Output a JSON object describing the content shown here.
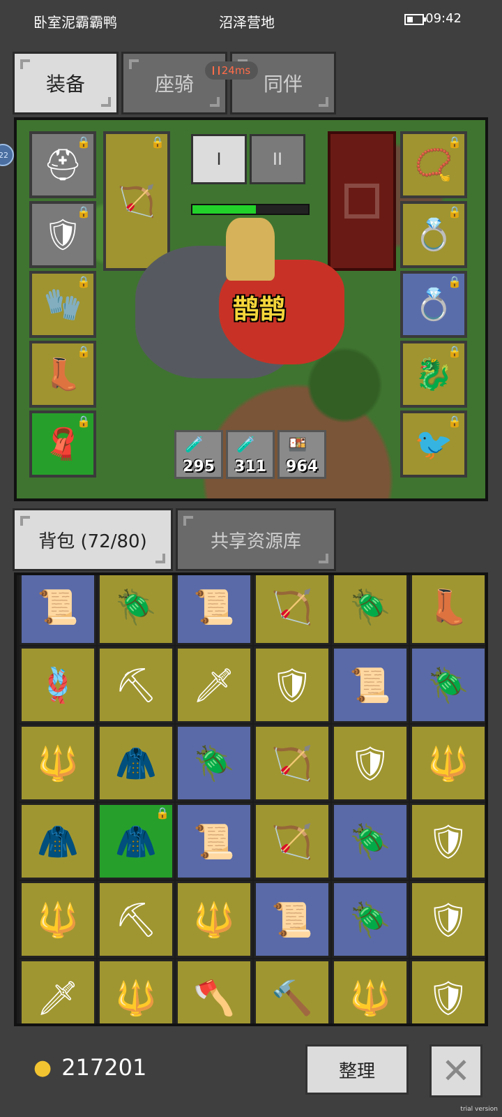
{
  "status": {
    "left_text": "卧室泥霸霸鸭",
    "center_text": "沼泽营地",
    "time": "09:42"
  },
  "main_tabs": [
    {
      "label": "装备",
      "active": true
    },
    {
      "label": "座骑",
      "active": false
    },
    {
      "label": "同伴",
      "active": false
    }
  ],
  "ping": "24ms",
  "side_badge": "22",
  "equipment": {
    "tier_buttons": [
      "I",
      "II"
    ],
    "hp_fraction": 0.55,
    "pet_name": "鹊鹊",
    "left_slots": [
      {
        "icon": "helmet-icon",
        "glyph": "⛑",
        "color": "grey",
        "locked": true
      },
      {
        "icon": "chest-armor-icon",
        "glyph": "🛡",
        "color": "grey",
        "locked": true
      },
      {
        "icon": "gauntlet-icon",
        "glyph": "🧤",
        "color": "olive",
        "locked": true
      },
      {
        "icon": "boots-icon",
        "glyph": "👢",
        "color": "olive",
        "locked": true
      },
      {
        "icon": "cape-icon",
        "glyph": "🧣",
        "color": "green",
        "locked": true
      }
    ],
    "weapon_slot": {
      "icon": "crossbow-icon",
      "glyph": "🏹",
      "locked": true
    },
    "right_slots": [
      {
        "icon": "amulet-icon",
        "glyph": "📿",
        "color": "olive",
        "locked": true
      },
      {
        "icon": "ring-gold-icon",
        "glyph": "💍",
        "color": "olive",
        "locked": true
      },
      {
        "icon": "ring-purple-icon",
        "glyph": "💍",
        "color": "blue",
        "locked": true
      },
      {
        "icon": "dragon-pet-icon",
        "glyph": "🐉",
        "color": "olive",
        "locked": true
      },
      {
        "icon": "magpie-pet-icon",
        "glyph": "🐦",
        "color": "olive",
        "locked": true
      }
    ],
    "consumables": [
      {
        "icon": "blue-potion-icon",
        "glyph": "🧪",
        "count": "295"
      },
      {
        "icon": "blue-potion-icon",
        "glyph": "🧪",
        "count": "311"
      },
      {
        "icon": "food-icon",
        "glyph": "🍱",
        "count": "964"
      }
    ]
  },
  "bag_tabs": [
    {
      "label": "背包 (72/80)",
      "active": true
    },
    {
      "label": "共享资源库",
      "active": false
    }
  ],
  "inventory": [
    {
      "icon": "scroll-icon",
      "glyph": "📜",
      "color": "blue"
    },
    {
      "icon": "golden-beetle-icon",
      "glyph": "🪲",
      "color": "olive"
    },
    {
      "icon": "scroll-icon",
      "glyph": "📜",
      "color": "blue"
    },
    {
      "icon": "crossbow-icon",
      "glyph": "🏹",
      "color": "olive"
    },
    {
      "icon": "golden-beetle-icon",
      "glyph": "🪲",
      "color": "olive"
    },
    {
      "icon": "boots-icon",
      "glyph": "👢",
      "color": "olive"
    },
    {
      "icon": "coiled-rope-icon",
      "glyph": "🪢",
      "color": "olive"
    },
    {
      "icon": "pickaxe-icon",
      "glyph": "⛏",
      "color": "olive"
    },
    {
      "icon": "sword-icon",
      "glyph": "🗡",
      "color": "olive"
    },
    {
      "icon": "chest-armor-icon",
      "glyph": "🛡",
      "color": "olive"
    },
    {
      "icon": "scroll-icon",
      "glyph": "📜",
      "color": "blue"
    },
    {
      "icon": "golden-beetle-icon",
      "glyph": "🪲",
      "color": "blue"
    },
    {
      "icon": "spear-icon",
      "glyph": "🔱",
      "color": "olive"
    },
    {
      "icon": "red-armor-icon",
      "glyph": "🧥",
      "color": "olive"
    },
    {
      "icon": "golden-beetle-icon",
      "glyph": "🪲",
      "color": "blue"
    },
    {
      "icon": "crossbow-icon",
      "glyph": "🏹",
      "color": "olive"
    },
    {
      "icon": "chest-armor-icon",
      "glyph": "🛡",
      "color": "olive"
    },
    {
      "icon": "trident-icon",
      "glyph": "🔱",
      "color": "olive"
    },
    {
      "icon": "red-armor-icon",
      "glyph": "🧥",
      "color": "olive"
    },
    {
      "icon": "red-armor-icon",
      "glyph": "🧥",
      "color": "green",
      "locked": true
    },
    {
      "icon": "scroll-icon",
      "glyph": "📜",
      "color": "blue"
    },
    {
      "icon": "bow-icon",
      "glyph": "🏹",
      "color": "olive"
    },
    {
      "icon": "golden-beetle-icon",
      "glyph": "🪲",
      "color": "blue"
    },
    {
      "icon": "chest-armor-icon",
      "glyph": "🛡",
      "color": "olive"
    },
    {
      "icon": "trident-icon",
      "glyph": "🔱",
      "color": "olive"
    },
    {
      "icon": "pickaxe-icon",
      "glyph": "⛏",
      "color": "olive"
    },
    {
      "icon": "trident-icon",
      "glyph": "🔱",
      "color": "olive"
    },
    {
      "icon": "scroll-icon",
      "glyph": "📜",
      "color": "blue"
    },
    {
      "icon": "golden-beetle-icon",
      "glyph": "🪲",
      "color": "blue"
    },
    {
      "icon": "chest-armor-icon",
      "glyph": "🛡",
      "color": "olive"
    },
    {
      "icon": "sword-icon",
      "glyph": "🗡",
      "color": "olive"
    },
    {
      "icon": "trident-icon",
      "glyph": "🔱",
      "color": "olive"
    },
    {
      "icon": "battle-axe-icon",
      "glyph": "🪓",
      "color": "olive"
    },
    {
      "icon": "hammer-icon",
      "glyph": "🔨",
      "color": "olive"
    },
    {
      "icon": "spear-icon",
      "glyph": "🔱",
      "color": "olive"
    },
    {
      "icon": "shield-icon",
      "glyph": "🛡",
      "color": "olive"
    }
  ],
  "footer": {
    "gold_amount": "217201",
    "sort_label": "整理",
    "close_glyph": "✕",
    "trial_text": "trial version"
  },
  "colors": {
    "olive": "#a09631",
    "blue": "#5a6aa8",
    "green": "#26a02a",
    "grey": "#7a7a7a"
  }
}
